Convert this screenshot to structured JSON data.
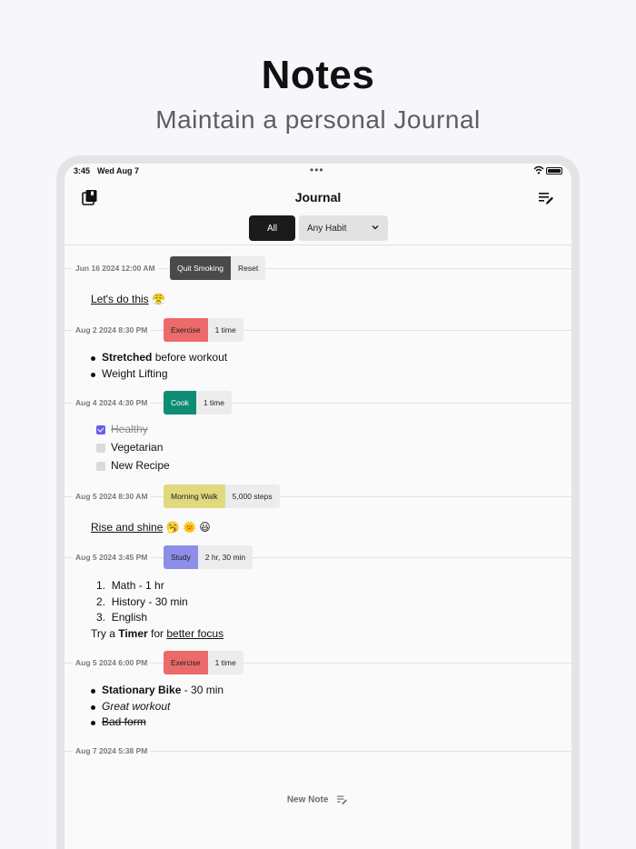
{
  "hero": {
    "title": "Notes",
    "subtitle": "Maintain a personal Journal"
  },
  "status": {
    "time": "3:45",
    "date": "Wed Aug 7"
  },
  "nav": {
    "title": "Journal"
  },
  "filters": {
    "all": "All",
    "habit": "Any Habit"
  },
  "entries": [
    {
      "date": "Jun 16 2024 12:00 AM",
      "habit": "Quit Smoking",
      "count": "Reset",
      "color": "#4a4a4a"
    },
    {
      "date": "Aug 2 2024 8:30 PM",
      "habit": "Exercise",
      "count": "1 time",
      "color": "#ec6a6a"
    },
    {
      "date": "Aug 4 2024 4:30 PM",
      "habit": "Cook",
      "count": "1 time",
      "color": "#0e8c74"
    },
    {
      "date": "Aug 5 2024 8:30 AM",
      "habit": "Morning Walk",
      "count": "5,000 steps",
      "color": "#e2d97e"
    },
    {
      "date": "Aug 5 2024 3:45 PM",
      "habit": "Study",
      "count": "2 hr, 30 min",
      "color": "#8c8ee8"
    },
    {
      "date": "Aug 5 2024 6:00 PM",
      "habit": "Exercise",
      "count": "1 time",
      "color": "#ec6a6a"
    },
    {
      "date": "Aug 7 2024 5:38 PM"
    }
  ],
  "notes": {
    "e1": {
      "text": "Let's do this",
      "emoji": "😤"
    },
    "e2": {
      "b1_bold": "Stretched",
      "b1_rest": " before workout",
      "b2": "Weight Lifting"
    },
    "e3": {
      "c1": "Healthy",
      "c2": "Vegetarian",
      "c3": "New Recipe"
    },
    "e4": {
      "text": "Rise and shine",
      "emoji": "🥱 🌞 😃"
    },
    "e5": {
      "n1": "1.",
      "l1": "Math - 1 hr",
      "n2": "2.",
      "l2": "History - 30 min",
      "n3": "3.",
      "l3": "English",
      "try": "Try a ",
      "timer": "Timer",
      "for": " for ",
      "focus": "better focus"
    },
    "e6": {
      "b1_bold": "Stationary Bike",
      "b1_rest": " - 30 min",
      "b2": "Great workout",
      "b3": "Bad form"
    }
  },
  "new_note": "New Note",
  "colors": {
    "accent": "#6a5ee8"
  }
}
